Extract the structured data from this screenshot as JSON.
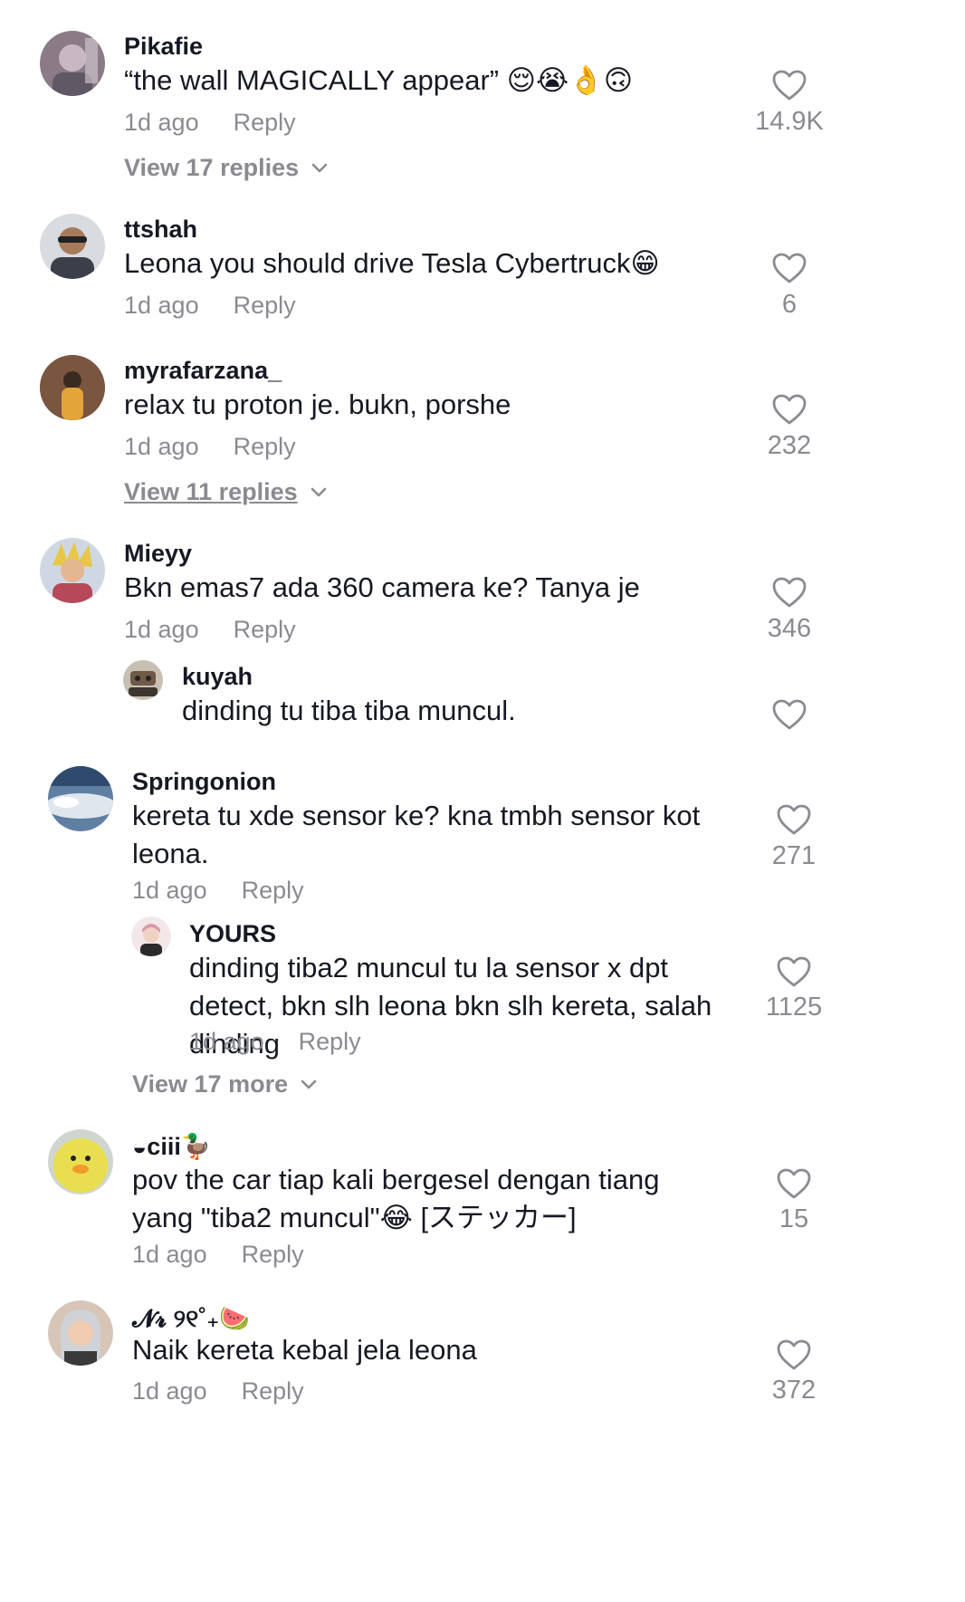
{
  "comments": [
    {
      "username": "Pikafie",
      "text": "“the wall MAGICALLY appear” 😌😭👌🙃",
      "time": "1d ago",
      "reply": "Reply",
      "likes": "14.9K",
      "view": "View 17 replies"
    },
    {
      "username": "ttshah",
      "text": "Leona you should drive Tesla Cybertruck😁",
      "time": "1d ago",
      "reply": "Reply",
      "likes": "6"
    },
    {
      "username": "myrafarzana_",
      "text": "relax tu proton je. bukn, porshe",
      "time": "1d ago",
      "reply": "Reply",
      "likes": "232",
      "view": "View 11 replies"
    },
    {
      "username": "Mieyy",
      "text": "Bkn emas7 ada 360 camera ke? Tanya je",
      "time": "1d ago",
      "reply": "Reply",
      "likes": "346",
      "reply_preview": {
        "username": "kuyah",
        "text": "dinding tu tiba tiba muncul."
      }
    },
    {
      "username": "Springonion",
      "text": "kereta tu xde sensor ke? kna tmbh sensor kot leona.",
      "time": "1d ago",
      "reply": "Reply",
      "likes": "271",
      "sub_reply": {
        "username": "YOURS",
        "text": "dinding tiba2 muncul tu la sensor x dpt detect, bkn slh leona bkn slh kereta, salah dinding",
        "time": "1d ago",
        "reply": "Reply",
        "likes": "1125"
      },
      "view": "View 17 more"
    },
    {
      "username": "◒ciii🦆",
      "text": "pov the car tiap kali bergesel dengan tiang yang \"tiba2 muncul\"😂 [ステッカー]",
      "time": "1d ago",
      "reply": "Reply",
      "likes": "15"
    },
    {
      "username": "𝓝𝓻 ୨୧˚₊🍉",
      "text": "Naik kereta kebal jela leona",
      "time": "1d ago",
      "reply": "Reply",
      "likes": "372"
    }
  ],
  "colors": {
    "text": "#161823",
    "muted": "#8a8b91"
  },
  "icons": {
    "like": "heart-outline-icon",
    "expand": "chevron-down-icon"
  }
}
